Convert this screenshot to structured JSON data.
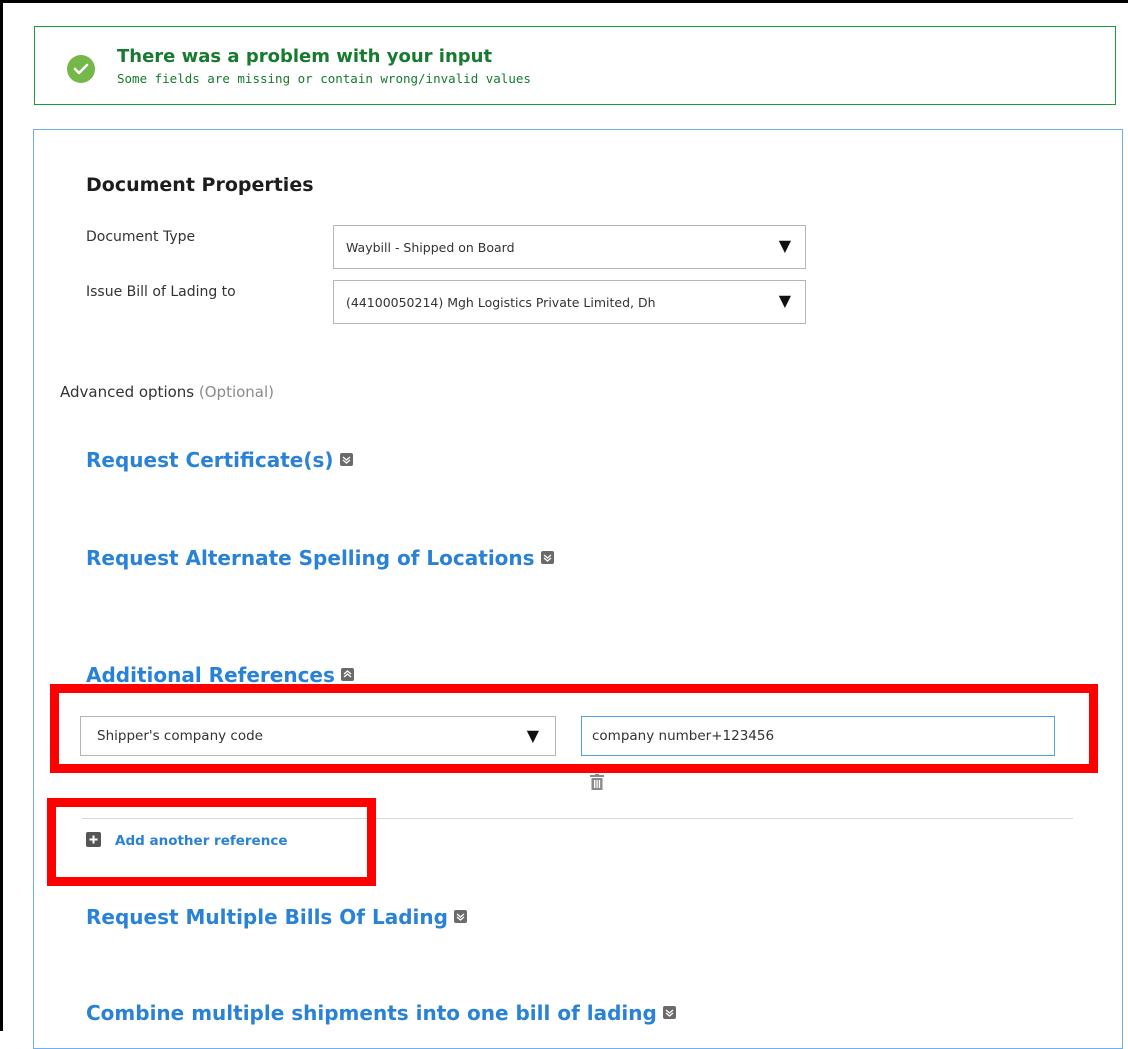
{
  "alert": {
    "title": "There was a problem with your input",
    "message": "Some fields are missing or contain wrong/invalid values",
    "icon": "check-circle-icon",
    "color": "#177a2e"
  },
  "document_properties": {
    "title": "Document Properties",
    "document_type_label": "Document Type",
    "document_type_value": "Waybill - Shipped on Board",
    "issue_to_label": "Issue Bill of Lading to",
    "issue_to_value": "(44100050214) Mgh Logistics Private Limited, Dh"
  },
  "advanced": {
    "label": "Advanced options",
    "optional_note": "(Optional)"
  },
  "sections": {
    "request_certificates": "Request Certificate(s)",
    "alternate_spelling": "Request Alternate Spelling of Locations",
    "additional_references": "Additional References",
    "multiple_bills": "Request Multiple Bills Of Lading",
    "combine_shipments": "Combine multiple shipments into one bill of lading"
  },
  "references": {
    "type_value": "Shipper's company code",
    "value": "company number+123456",
    "add_label": "Add another reference"
  },
  "accent_color": "#2a82d6",
  "highlight_color": "#ff0000"
}
